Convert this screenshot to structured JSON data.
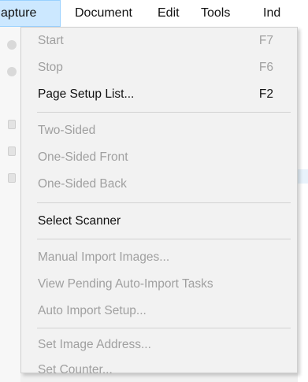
{
  "menubar": {
    "items": [
      {
        "label": "apture",
        "active": true
      },
      {
        "label": "Document",
        "active": false
      },
      {
        "label": "Edit",
        "active": false
      },
      {
        "label": "Tools",
        "active": false
      },
      {
        "label": "Ind",
        "active": false
      }
    ]
  },
  "capture_menu": {
    "items": [
      {
        "label": "Start",
        "shortcut": "F7",
        "enabled": false
      },
      {
        "label": "Stop",
        "shortcut": "F6",
        "enabled": false
      },
      {
        "label": "Page Setup List...",
        "shortcut": "F2",
        "enabled": true
      },
      {
        "label": "Two-Sided",
        "shortcut": "",
        "enabled": false
      },
      {
        "label": "One-Sided Front",
        "shortcut": "",
        "enabled": false
      },
      {
        "label": "One-Sided Back",
        "shortcut": "",
        "enabled": false
      },
      {
        "label": "Select Scanner",
        "shortcut": "",
        "enabled": true
      },
      {
        "label": "Manual Import Images...",
        "shortcut": "",
        "enabled": false
      },
      {
        "label": "View Pending Auto-Import Tasks",
        "shortcut": "",
        "enabled": false
      },
      {
        "label": "Auto Import Setup...",
        "shortcut": "",
        "enabled": false
      },
      {
        "label": "Set Image Address...",
        "shortcut": "",
        "enabled": false
      },
      {
        "label": "Set Counter...",
        "shortcut": "",
        "enabled": false
      }
    ]
  },
  "colors": {
    "active_menu_bg": "#cce8ff",
    "active_menu_border": "#99d1ff",
    "disabled_text": "#a0a0a0",
    "enabled_text": "#111111"
  }
}
